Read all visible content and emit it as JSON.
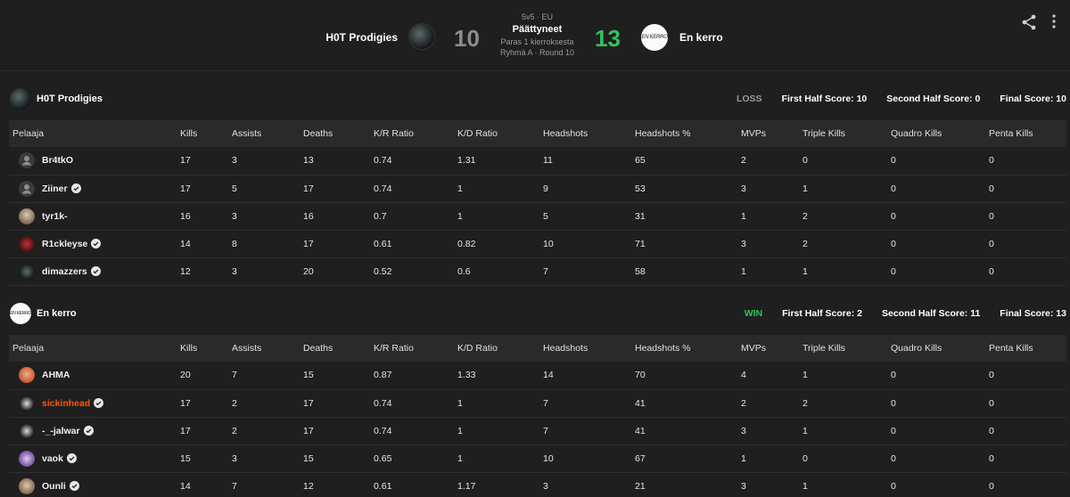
{
  "header": {
    "team_left": "H0T Prodigies",
    "team_right": "En kerro",
    "score_left": "10",
    "score_right": "13",
    "format": "5v5 · EU",
    "status": "Päättyneet",
    "best_of": "Paras 1 kierroksesta",
    "round_info": "Ryhmä A · Round 10",
    "team_right_logo_text": "EN KERRO",
    "colors": {
      "win": "#32c35a",
      "loss": "#8c8c8c",
      "highlight_player": "#ff5500"
    }
  },
  "columns": [
    "Pelaaja",
    "Kills",
    "Assists",
    "Deaths",
    "K/R Ratio",
    "K/D Ratio",
    "Headshots",
    "Headshots %",
    "MVPs",
    "Triple Kills",
    "Quadro Kills",
    "Penta Kills"
  ],
  "teams": [
    {
      "name": "H0T Prodigies",
      "result": "LOSS",
      "first_half": "First Half Score: 10",
      "second_half": "Second Half Score: 0",
      "final": "Final Score: 10",
      "players": [
        {
          "name": "Br4tkO",
          "verified": false,
          "avatar": "default",
          "stats": [
            "17",
            "3",
            "13",
            "0.74",
            "1.31",
            "11",
            "65",
            "2",
            "0",
            "0",
            "0"
          ]
        },
        {
          "name": "Ziiner",
          "verified": true,
          "avatar": "default",
          "stats": [
            "17",
            "5",
            "17",
            "0.74",
            "1",
            "9",
            "53",
            "3",
            "1",
            "0",
            "0"
          ]
        },
        {
          "name": "tyr1k-",
          "verified": false,
          "avatar": "portrait",
          "stats": [
            "16",
            "3",
            "16",
            "0.7",
            "1",
            "5",
            "31",
            "1",
            "2",
            "0",
            "0"
          ]
        },
        {
          "name": "R1ckleyse",
          "verified": true,
          "avatar": "red",
          "stats": [
            "14",
            "8",
            "17",
            "0.61",
            "0.82",
            "10",
            "71",
            "3",
            "2",
            "0",
            "0"
          ]
        },
        {
          "name": "dimazzers",
          "verified": true,
          "avatar": "dark",
          "stats": [
            "12",
            "3",
            "20",
            "0.52",
            "0.6",
            "7",
            "58",
            "1",
            "1",
            "0",
            "0"
          ]
        }
      ]
    },
    {
      "name": "En kerro",
      "result": "WIN",
      "first_half": "First Half Score: 2",
      "second_half": "Second Half Score: 11",
      "final": "Final Score: 13",
      "players": [
        {
          "name": "AHMA",
          "verified": false,
          "avatar": "orange",
          "stats": [
            "20",
            "7",
            "15",
            "0.87",
            "1.33",
            "14",
            "70",
            "4",
            "1",
            "0",
            "0"
          ]
        },
        {
          "name": "sickinhead",
          "verified": true,
          "avatar": "mono",
          "highlight": true,
          "stats": [
            "17",
            "2",
            "17",
            "0.74",
            "1",
            "7",
            "41",
            "2",
            "2",
            "0",
            "0"
          ]
        },
        {
          "name": "-_-jalwar",
          "verified": true,
          "avatar": "mono",
          "stats": [
            "17",
            "2",
            "17",
            "0.74",
            "1",
            "7",
            "41",
            "3",
            "1",
            "0",
            "0"
          ]
        },
        {
          "name": "vaok",
          "verified": true,
          "avatar": "purple",
          "stats": [
            "15",
            "3",
            "15",
            "0.65",
            "1",
            "10",
            "67",
            "1",
            "0",
            "0",
            "0"
          ]
        },
        {
          "name": "Ounli",
          "verified": true,
          "avatar": "face",
          "stats": [
            "14",
            "7",
            "12",
            "0.61",
            "1.17",
            "3",
            "21",
            "3",
            "1",
            "0",
            "0"
          ]
        }
      ]
    }
  ]
}
